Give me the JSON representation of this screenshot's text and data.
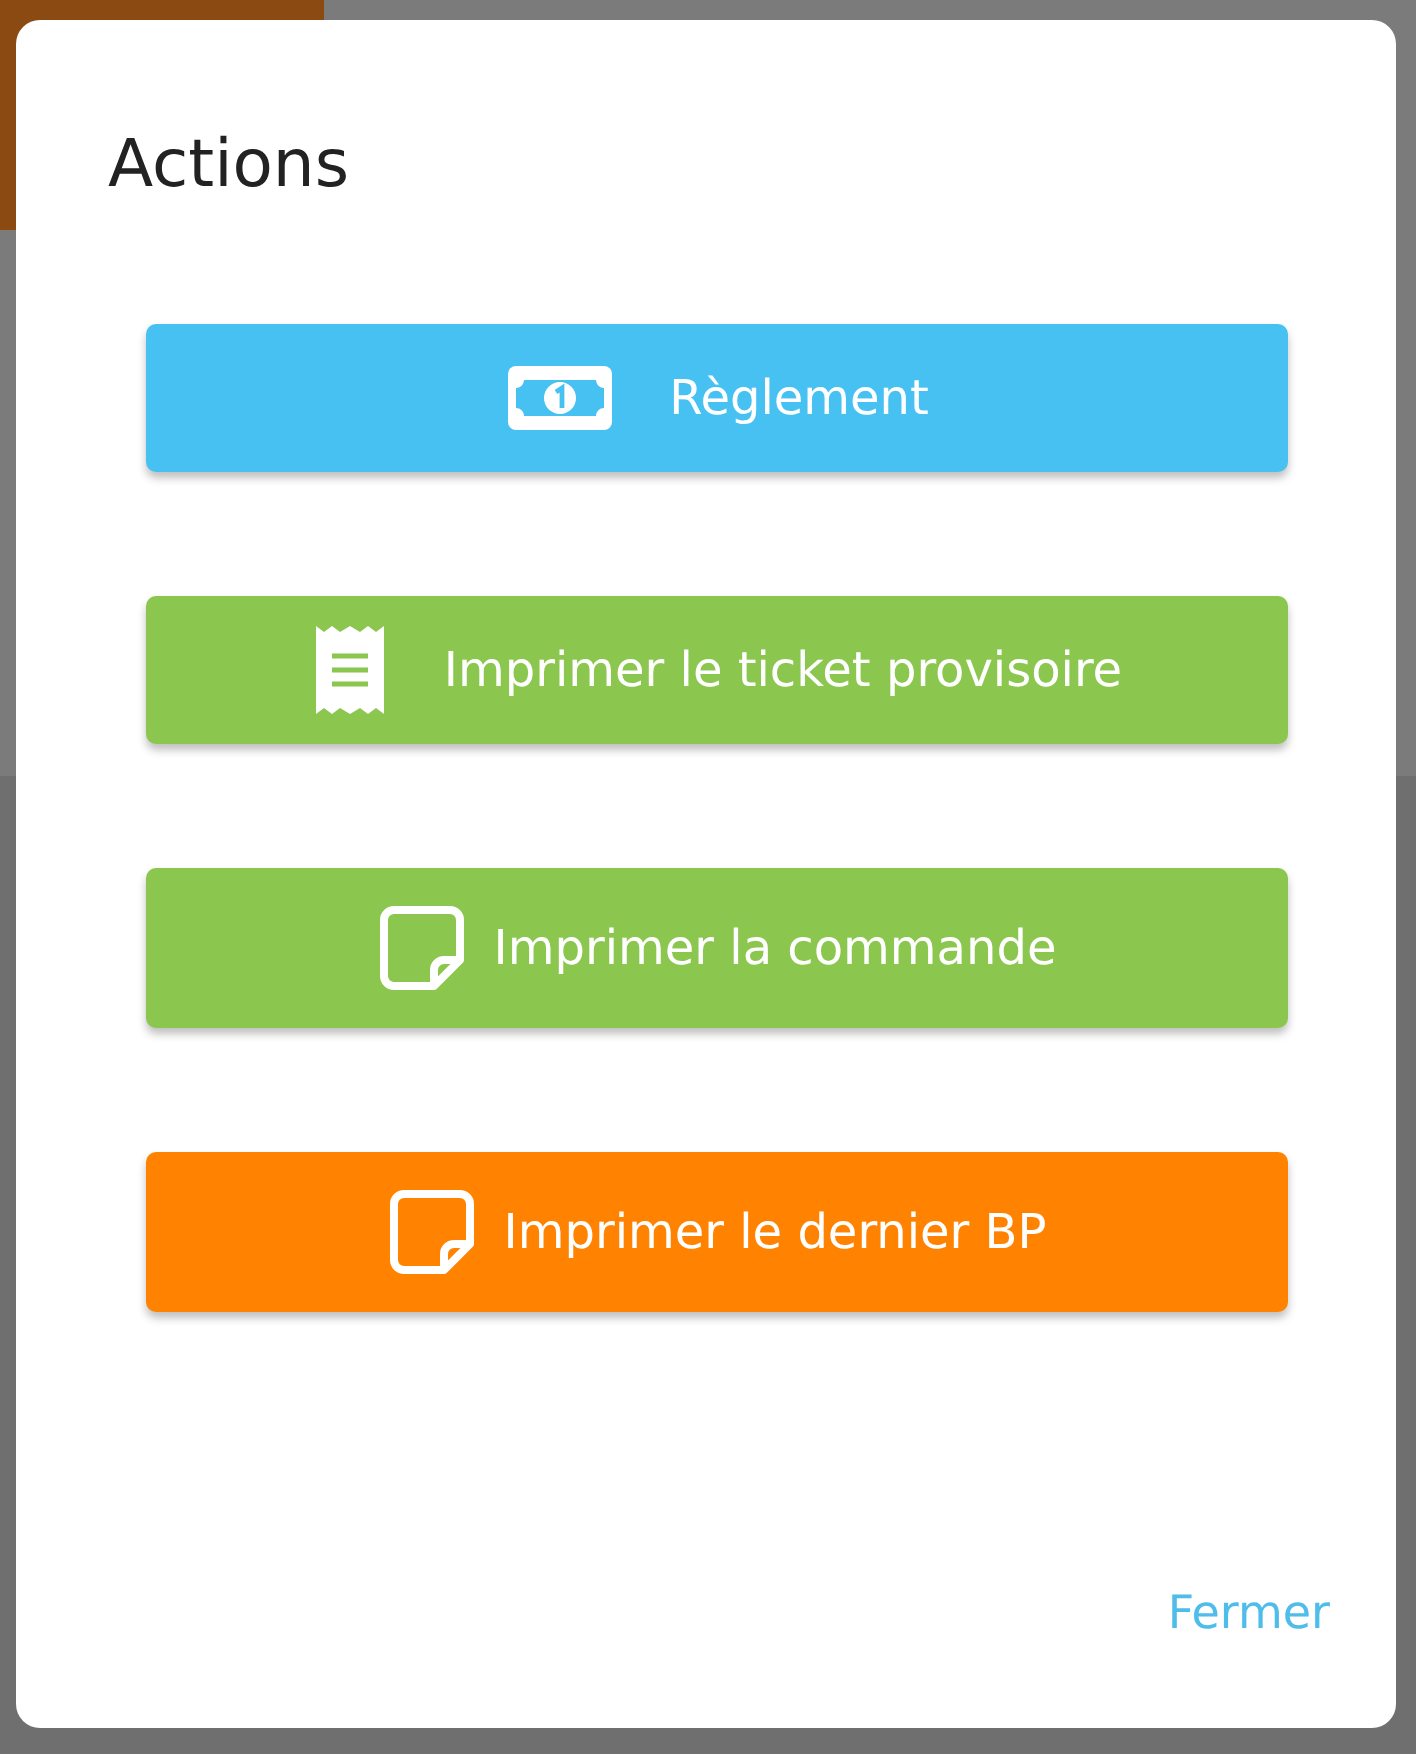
{
  "dialog": {
    "title": "Actions",
    "actions": [
      {
        "label": "Règlement",
        "kind": "payment",
        "color": "#47c1f2"
      },
      {
        "label": "Imprimer le ticket provisoire",
        "kind": "receipt",
        "color": "#8bc64e"
      },
      {
        "label": "Imprimer la commande",
        "kind": "note",
        "color": "#8bc64e"
      },
      {
        "label": "Imprimer le dernier BP",
        "kind": "note",
        "color": "#ff8300"
      }
    ],
    "close_button": "Fermer"
  }
}
